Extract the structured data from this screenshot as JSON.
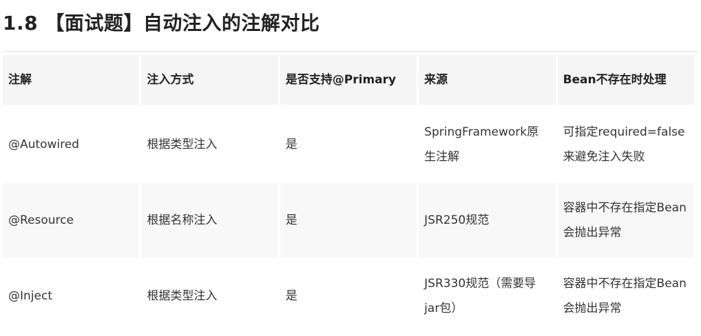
{
  "heading": "1.8 【面试题】自动注入的注解对比",
  "table": {
    "headers": [
      "注解",
      "注入方式",
      "是否支持@Primary",
      "来源",
      "Bean不存在时处理"
    ],
    "rows": [
      [
        "@Autowired",
        "根据类型注入",
        "是",
        "SpringFramework原生注解",
        "可指定required=false来避免注入失败"
      ],
      [
        "@Resource",
        "根据名称注入",
        "是",
        "JSR250规范",
        "容器中不存在指定Bean会抛出异常"
      ],
      [
        "@Inject",
        "根据类型注入",
        "是",
        "JSR330规范（需要导jar包）",
        "容器中不存在指定Bean会抛出异常"
      ]
    ]
  }
}
